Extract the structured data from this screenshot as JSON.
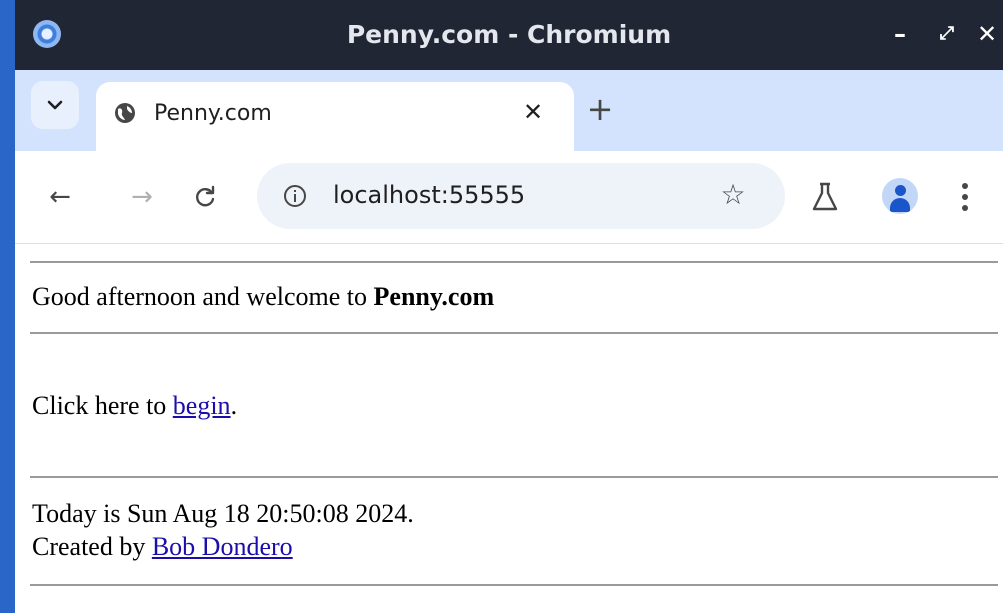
{
  "window": {
    "title": "Penny.com - Chromium",
    "minimize_glyph": "–",
    "maximize_glyph": "⤢",
    "close_glyph": "✕"
  },
  "tabs": [
    {
      "title": "Penny.com",
      "favicon": "globe-icon",
      "active": true
    }
  ],
  "tabstrip": {
    "new_tab_glyph": "+",
    "close_glyph": "✕"
  },
  "toolbar": {
    "back_glyph": "←",
    "forward_glyph": "→",
    "reload_glyph": "C",
    "star_glyph": "☆",
    "url": "localhost:55555",
    "icons": [
      "back-arrow-icon",
      "forward-arrow-icon",
      "reload-icon",
      "info-icon",
      "bookmark-star-icon",
      "labs-flask-icon",
      "profile-avatar-icon",
      "kebab-menu-icon"
    ]
  },
  "page": {
    "greeting_prefix": "Good afternoon and welcome to ",
    "greeting_brand": "Penny.com",
    "begin_prefix": "Click here to ",
    "begin_link": "begin",
    "begin_suffix": ".",
    "date_line": "Today is Sun Aug 18 20:50:08 2024.",
    "created_prefix": "Created by ",
    "author_link": "Bob Dondero"
  },
  "colors": {
    "titlebar": "#202633",
    "tabstrip": "#d3e3fd",
    "omnibox": "#eef2f9",
    "link": "#1a0dab",
    "rule": "#9a9a9a"
  }
}
